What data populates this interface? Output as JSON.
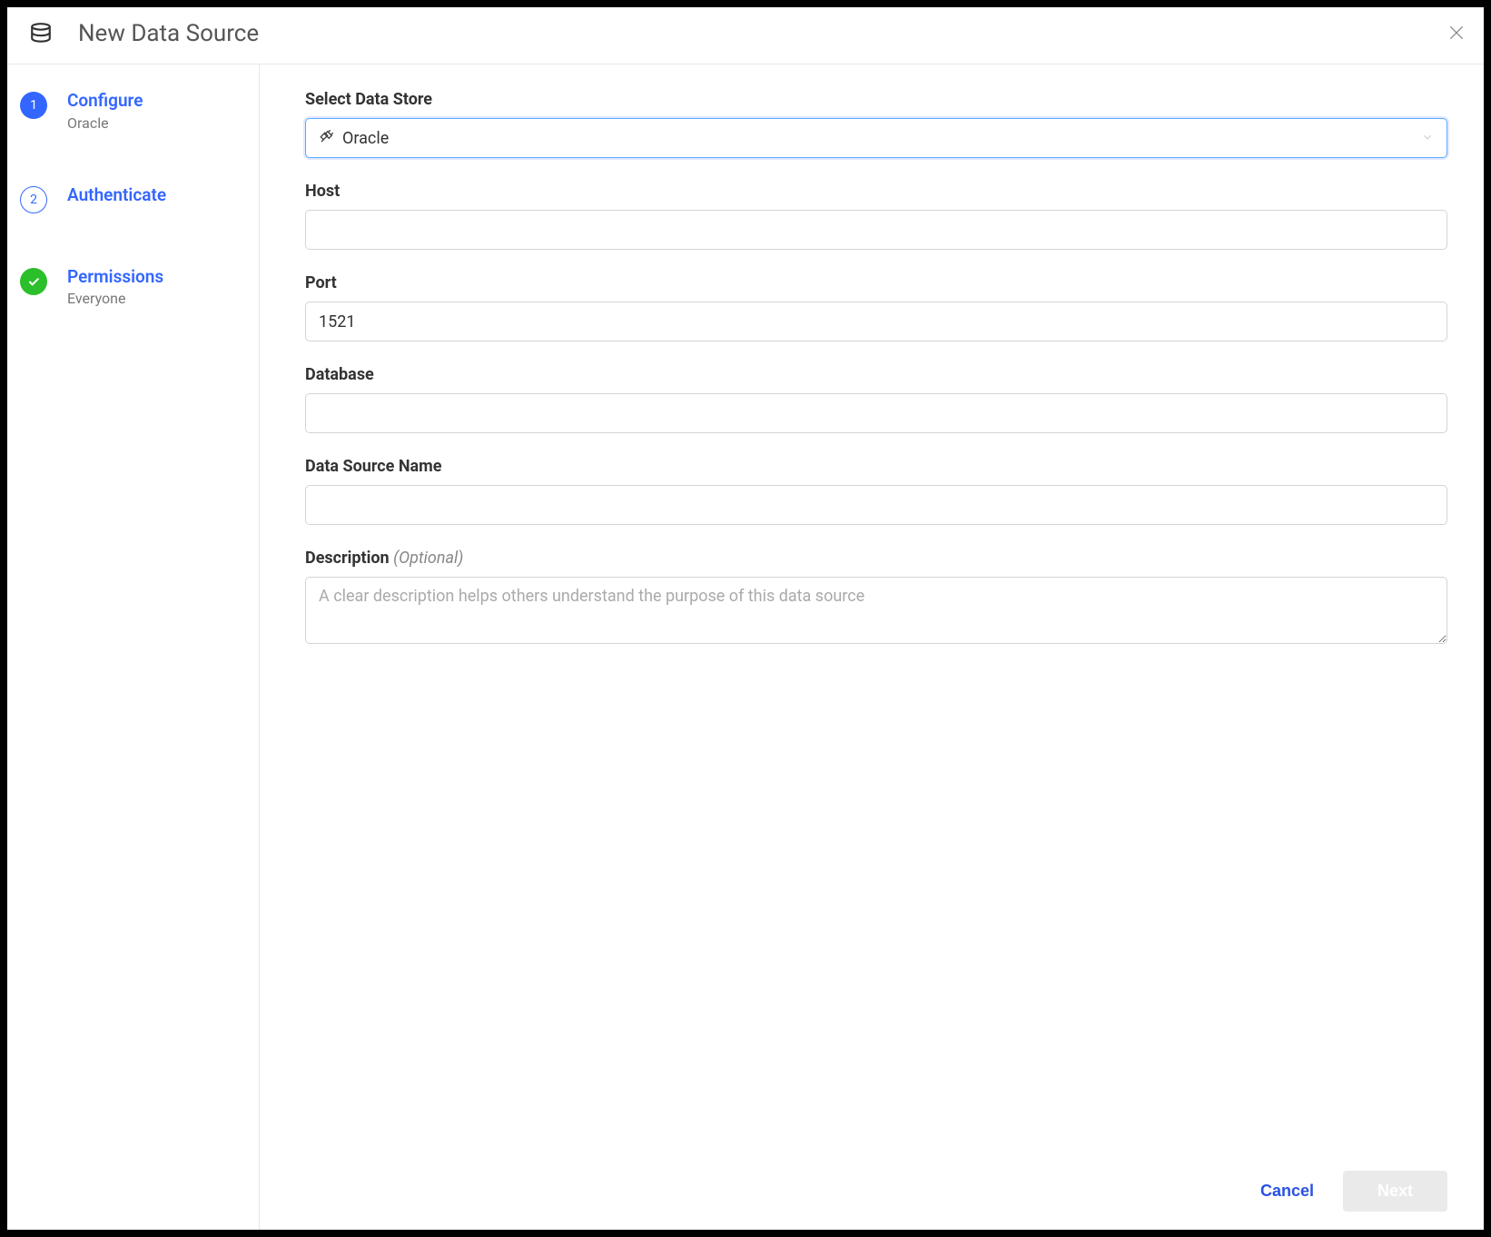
{
  "header": {
    "title": "New Data Source"
  },
  "sidebar": {
    "steps": [
      {
        "label": "Configure",
        "sub": "Oracle",
        "badge": "1",
        "type": "filled"
      },
      {
        "label": "Authenticate",
        "sub": "",
        "badge": "2",
        "type": "outline"
      },
      {
        "label": "Permissions",
        "sub": "Everyone",
        "badge": "",
        "type": "check"
      }
    ]
  },
  "form": {
    "select_label": "Select Data Store",
    "select_value": "Oracle",
    "host_label": "Host",
    "host_value": "",
    "port_label": "Port",
    "port_value": "1521",
    "database_label": "Database",
    "database_value": "",
    "name_label": "Data Source Name",
    "name_value": "",
    "desc_label": "Description",
    "desc_optional": "(Optional)",
    "desc_placeholder": "A clear description helps others understand the purpose of this data source",
    "desc_value": ""
  },
  "footer": {
    "cancel": "Cancel",
    "next": "Next"
  }
}
